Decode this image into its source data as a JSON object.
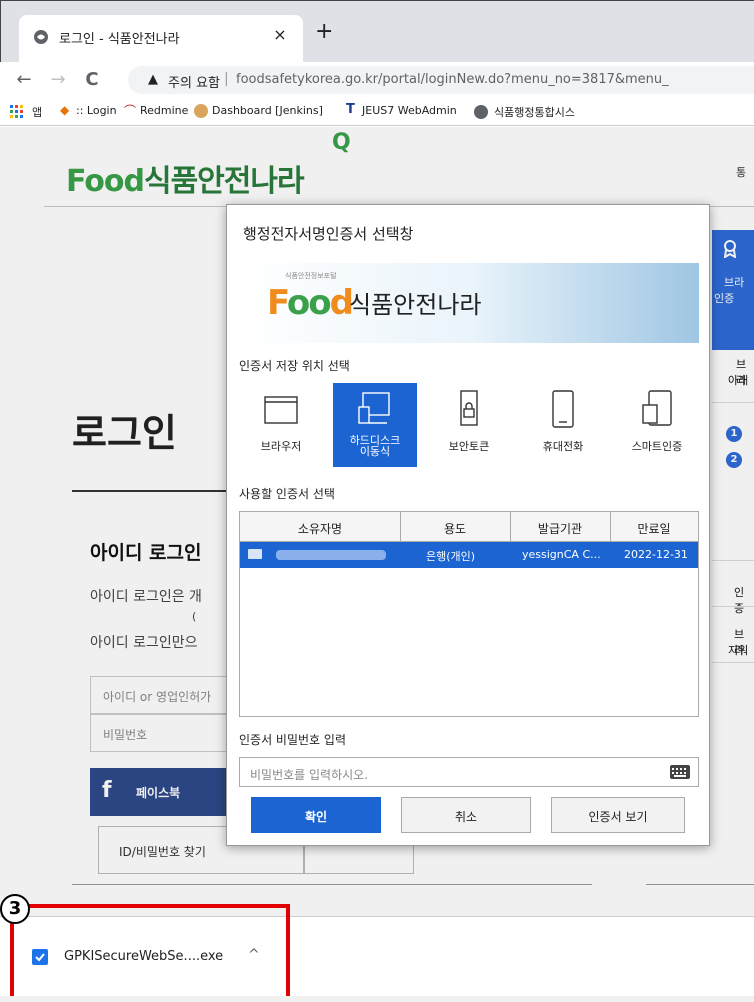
{
  "browser": {
    "tab_title": "로그인 - 식품안전나라",
    "tab_close": "×",
    "new_tab": "+",
    "back": "←",
    "forward": "→",
    "reload": "C",
    "warning_icon": "▲",
    "warning_text": "주의 요함",
    "url_separator": "|",
    "url": "foodsafetykorea.go.kr/portal/loginNew.do?menu_no=3817&menu_",
    "bookmarks": [
      {
        "label": "앱",
        "icon": "apps-grid-icon"
      },
      {
        "label": ":: Login",
        "icon": "login-icon"
      },
      {
        "label": "Redmine",
        "icon": "redmine-icon"
      },
      {
        "label": "Dashboard [Jenkins]",
        "icon": "jenkins-icon"
      },
      {
        "label": "JEUS7 WebAdmin",
        "icon": "jeus-icon"
      },
      {
        "label": "식품행정통합시스",
        "icon": "globe-icon"
      }
    ]
  },
  "page": {
    "logo_q": "Q",
    "logo_food": "Food",
    "logo_name": "식품안전나라",
    "top_right": "통",
    "login_title": "로그인",
    "id_login_title": "아이디 로그인",
    "id_desc1": "아이디 로그인은 개",
    "id_desc2": "(",
    "id_desc3": "아이디 로그인만으",
    "id_placeholder": "아이디 or 영업인허가",
    "pw_placeholder": "비밀번호",
    "facebook_icon": "f",
    "facebook_label": "페이스북",
    "find_id": "ID/비밀번호 찾기",
    "side": {
      "award_icon": "award-icon",
      "blue_text1": "브라",
      "blue_text2": "인증",
      "text3": "브라",
      "text4": "아래",
      "num1": "1",
      "num2": "2",
      "item5": "인증",
      "item6": "브라",
      "item7": "지워"
    }
  },
  "dialog": {
    "title": "행정전자서명인증서 선택창",
    "banner_small": "식품안전정보포털",
    "banner_food_f": "F",
    "banner_food_oo": "oo",
    "banner_food_d": "d",
    "banner_name": "식품안전나라",
    "storage_label": "인증서 저장 위치 선택",
    "media": [
      {
        "label": "브라우저",
        "icon": "browser-window-icon",
        "selected": false
      },
      {
        "label": "하드디스크\n이동식",
        "icon": "hard-disk-removable-icon",
        "selected": true
      },
      {
        "label": "보안토큰",
        "icon": "security-token-icon",
        "selected": false
      },
      {
        "label": "휴대전화",
        "icon": "mobile-phone-icon",
        "selected": false
      },
      {
        "label": "스마트인증",
        "icon": "smart-auth-icon",
        "selected": false
      }
    ],
    "cert_label": "사용할 인증서 선택",
    "columns": [
      "소유자명",
      "용도",
      "발급기관",
      "만료일"
    ],
    "rows": [
      {
        "owner": "",
        "usage": "은행(개인)",
        "issuer": "yessignCA C...",
        "expiry": "2022-12-31"
      }
    ],
    "pw_label": "인증서 비밀번호 입력",
    "pw_placeholder": "비밀번호를 입력하시오.",
    "keyboard_icon": "keyboard-icon",
    "ok": "확인",
    "cancel": "취소",
    "view_cert": "인증서 보기"
  },
  "download": {
    "filename": "GPKISecureWebSe....exe",
    "chevron": "^",
    "callout_number": "3"
  },
  "colors": {
    "accent": "#1b64d2",
    "callout": "#e00000",
    "facebook": "#2e4a8b"
  }
}
